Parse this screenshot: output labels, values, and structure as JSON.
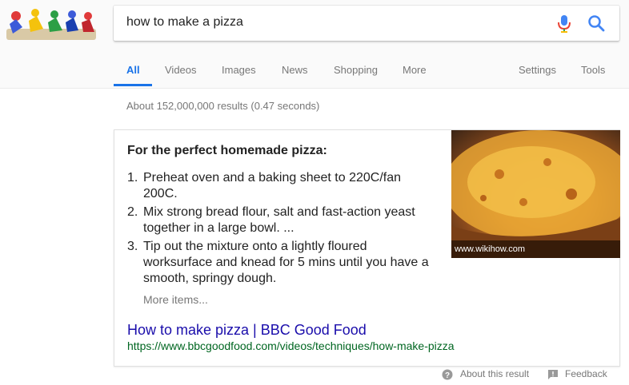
{
  "search": {
    "query": "how to make a pizza"
  },
  "tabs": [
    {
      "label": "All",
      "active": true
    },
    {
      "label": "Videos"
    },
    {
      "label": "Images"
    },
    {
      "label": "News"
    },
    {
      "label": "Shopping"
    },
    {
      "label": "More"
    }
  ],
  "tools": {
    "settings_label": "Settings",
    "tools_label": "Tools"
  },
  "results": {
    "stats": "About 152,000,000 results (0.47 seconds)"
  },
  "featured": {
    "heading": "For the perfect homemade pizza:",
    "steps": [
      {
        "num": "1.",
        "text": "Preheat oven and a baking sheet to 220C/fan 200C."
      },
      {
        "num": "2.",
        "text": "Mix strong bread flour, salt and fast-action yeast together in a large bowl. ..."
      },
      {
        "num": "3.",
        "text": "Tip out the mixture onto a lightly floured worksurface and knead for 5 mins until you have a smooth, springy dough."
      }
    ],
    "more_items": "More items...",
    "image_caption": "www.wikihow.com",
    "result_title": "How to make pizza | BBC Good Food",
    "result_url": "https://www.bbcgoodfood.com/videos/techniques/how-make-pizza"
  },
  "footer": {
    "about_label": "About this result",
    "feedback_label": "Feedback"
  },
  "colors": {
    "accent": "#1a73e8",
    "link": "#1a0dab",
    "url": "#006621"
  }
}
